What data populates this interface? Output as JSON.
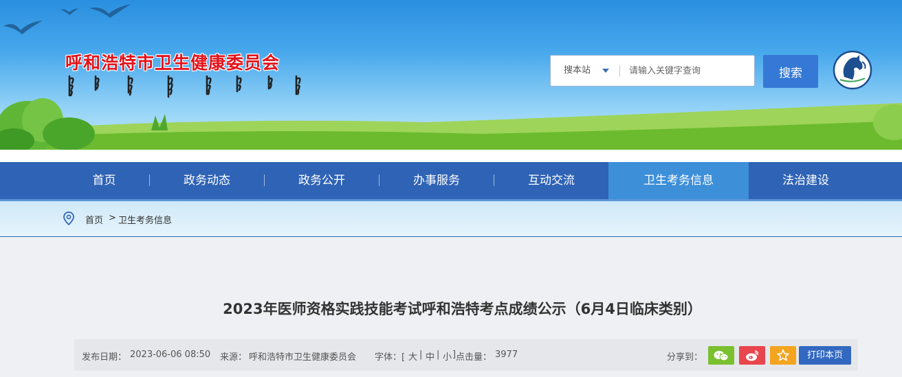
{
  "header": {
    "site_title": "呼和浩特市卫生健康委员会"
  },
  "search": {
    "scope_label": "搜本站",
    "placeholder": "请输入关键字查询",
    "button_label": "搜索"
  },
  "nav": {
    "items": [
      {
        "label": "首页"
      },
      {
        "label": "政务动态"
      },
      {
        "label": "政务公开"
      },
      {
        "label": "办事服务"
      },
      {
        "label": "互动交流"
      },
      {
        "label": "卫生考务信息",
        "active": true
      },
      {
        "label": "法治建设"
      }
    ]
  },
  "breadcrumb": {
    "home": "首页",
    "separator": ">",
    "current": "卫生考务信息"
  },
  "article": {
    "title": "2023年医师资格实践技能考试呼和浩特考点成绩公示（6月4日临床类别）",
    "publish_label": "发布日期：",
    "publish_date": "2023-06-06 08:50",
    "source_label": "来源：",
    "source": "呼和浩特市卫生健康委员会",
    "font_label": "字体：[",
    "font_large": "大",
    "font_medium": "中",
    "font_small": "小",
    "font_close": "]",
    "pipe": "|",
    "views_label": "点击量：",
    "views": "3977",
    "share_label": "分享到：",
    "print_label": "打印本页"
  },
  "colors": {
    "title_red": "#e2131b",
    "nav_blue": "#2f63b5",
    "nav_active": "#3d8fd8",
    "search_button": "#3578d6",
    "wechat_green": "#7bc02f",
    "weibo_red": "#e8454d",
    "favorite_orange": "#f4a41f"
  }
}
